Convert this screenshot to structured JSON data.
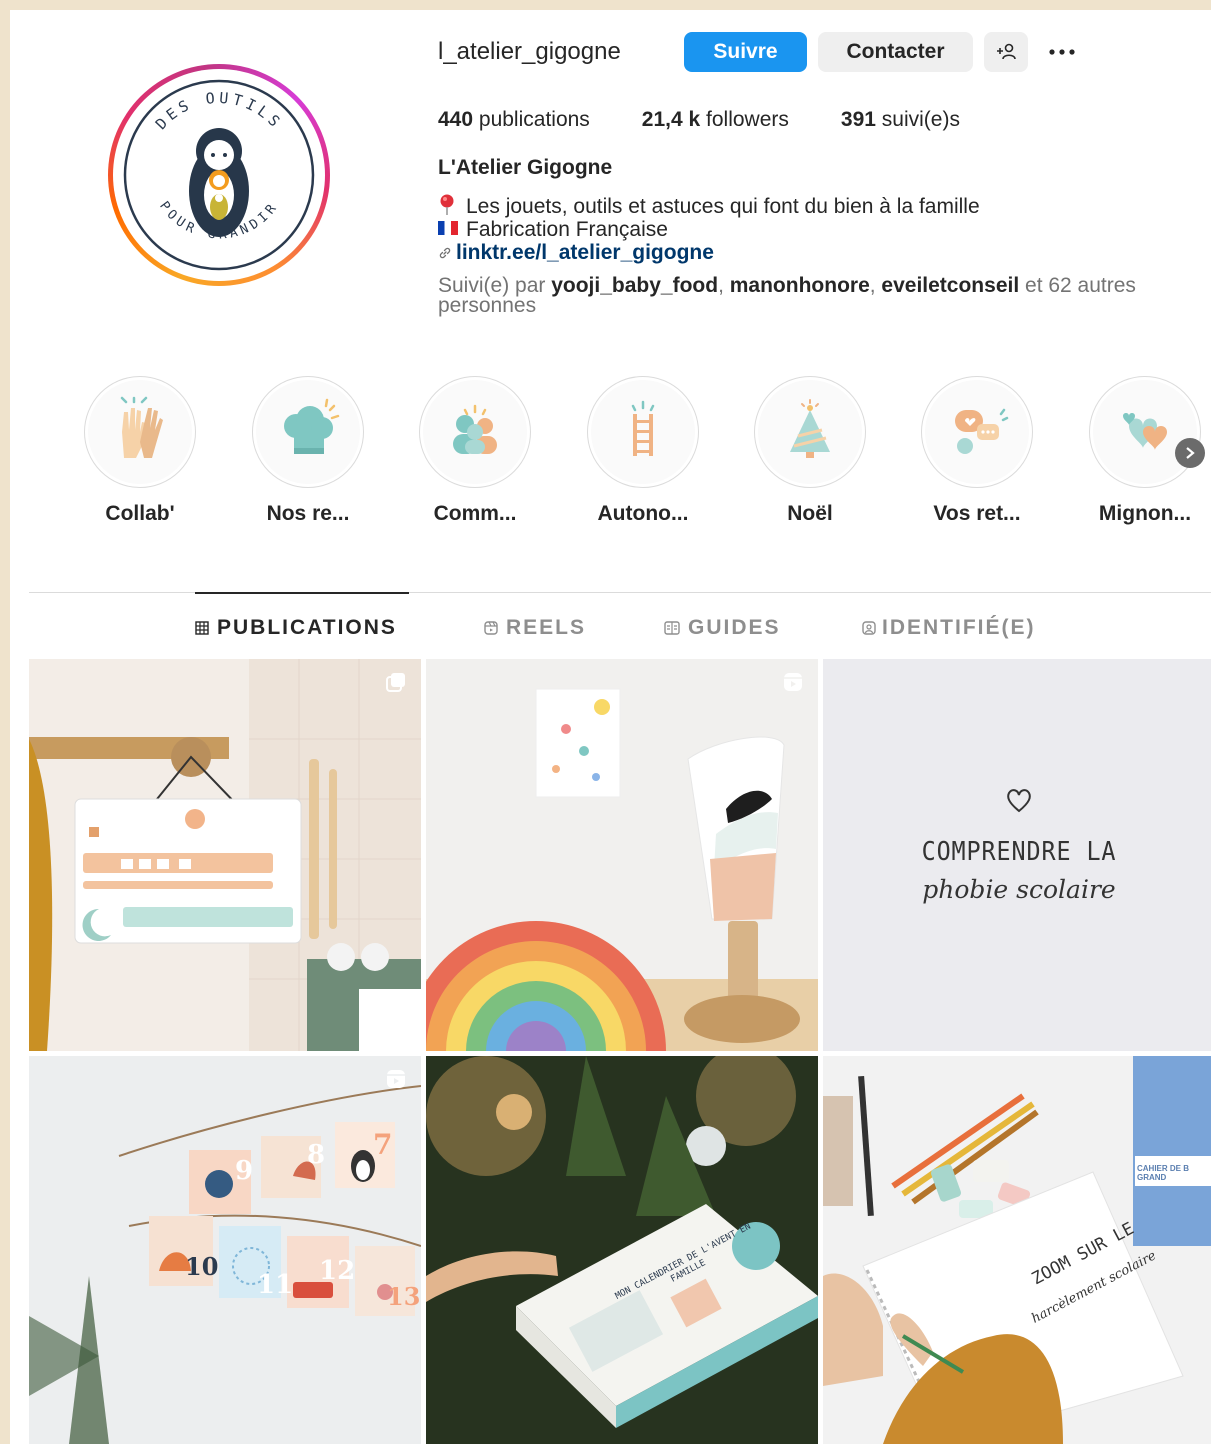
{
  "profile": {
    "username": "l_atelier_gigogne",
    "logo_text_top": "DES OUTILS",
    "logo_text_bottom": "POUR GRANDIR",
    "follow_label": "Suivre",
    "contact_label": "Contacter",
    "add_user_icon": "add-user-icon",
    "more_icon": "more-icon",
    "stats": {
      "publications_count": "440",
      "publications_label": "publications",
      "followers_count": "21,4 k",
      "followers_label": "followers",
      "following_count": "391",
      "following_label": "suivi(e)s"
    },
    "full_name": "L'Atelier Gigogne",
    "bio_line1": "Les jouets, outils et astuces qui font du bien à la famille",
    "bio_line2": "Fabrication Française",
    "link": "linktr.ee/l_atelier_gigogne",
    "followed_by_prefix": "Suivi(e) par",
    "followed_by_users": [
      "yooji_baby_food",
      "manonhonore",
      "eveiletconseil"
    ],
    "followed_by_suffix": "et 62 autres personnes"
  },
  "highlights": [
    {
      "label": "Collab'",
      "icon": "high-five-icon"
    },
    {
      "label": "Nos re...",
      "icon": "chef-hat-icon"
    },
    {
      "label": "Comm...",
      "icon": "community-icon"
    },
    {
      "label": "Autono...",
      "icon": "ladder-icon"
    },
    {
      "label": "Noël",
      "icon": "christmas-tree-icon"
    },
    {
      "label": "Vos ret...",
      "icon": "chat-bubble-icon"
    },
    {
      "label": "Mignon...",
      "icon": "hearts-icon"
    }
  ],
  "tabs": [
    {
      "label": "PUBLICATIONS",
      "icon": "grid-icon",
      "active": true
    },
    {
      "label": "REELS",
      "icon": "reels-icon",
      "active": false
    },
    {
      "label": "GUIDES",
      "icon": "guides-icon",
      "active": false
    },
    {
      "label": "IDENTIFIÉ(E)",
      "icon": "tagged-icon",
      "active": false
    }
  ],
  "posts": [
    {
      "type": "carousel",
      "icon": "carousel-icon",
      "subject": "routine board"
    },
    {
      "type": "reel",
      "icon": "reel-icon",
      "subject": "night light and rainbow"
    },
    {
      "type": "image",
      "title": "COMPRENDRE LA",
      "subtitle": "phobie scolaire"
    },
    {
      "type": "reel",
      "icon": "reel-icon",
      "subject": "advent calendar",
      "numbers": [
        "9",
        "8",
        "7",
        "10",
        "11",
        "12",
        "13"
      ]
    },
    {
      "type": "image",
      "subject": "game box",
      "box_text": "MON CALENDRIER DE L'AVENT EN FAMILLE"
    },
    {
      "type": "image",
      "title": "ZOOM SUR LE",
      "subtitle": "harcèlement scolaire",
      "notebook_label": "CAHIER DE B GRAND"
    }
  ],
  "colors": {
    "follow_button": "#1a95f0",
    "link": "#00376b",
    "page_background": "#efe3cc"
  }
}
